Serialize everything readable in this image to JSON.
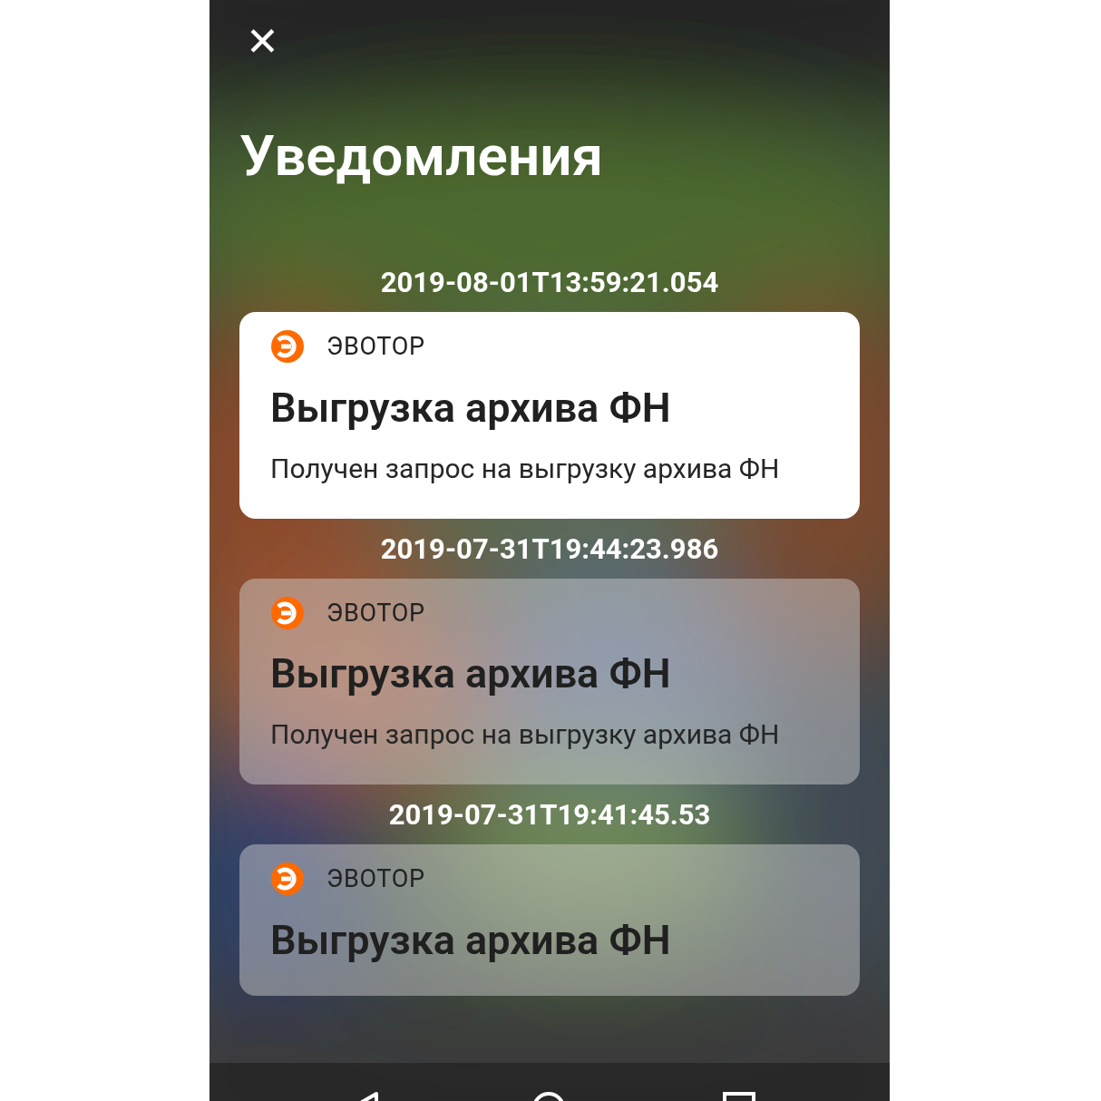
{
  "screen": {
    "title": "Уведомления",
    "close_icon": "✕"
  },
  "notifications": [
    {
      "timestamp": "2019-08-01T13:59:21.054",
      "app": "ЭВОТОР",
      "title": "Выгрузка архива ФН",
      "body": "Получен запрос на выгрузку архива ФН",
      "highlighted": true
    },
    {
      "timestamp": "2019-07-31T19:44:23.986",
      "app": "ЭВОТОР",
      "title": "Выгрузка архива ФН",
      "body": "Получен запрос на выгрузку архива ФН",
      "highlighted": false
    },
    {
      "timestamp": "2019-07-31T19:41:45.53",
      "app": "ЭВОТОР",
      "title": "Выгрузка архива ФН",
      "highlighted": false
    }
  ]
}
